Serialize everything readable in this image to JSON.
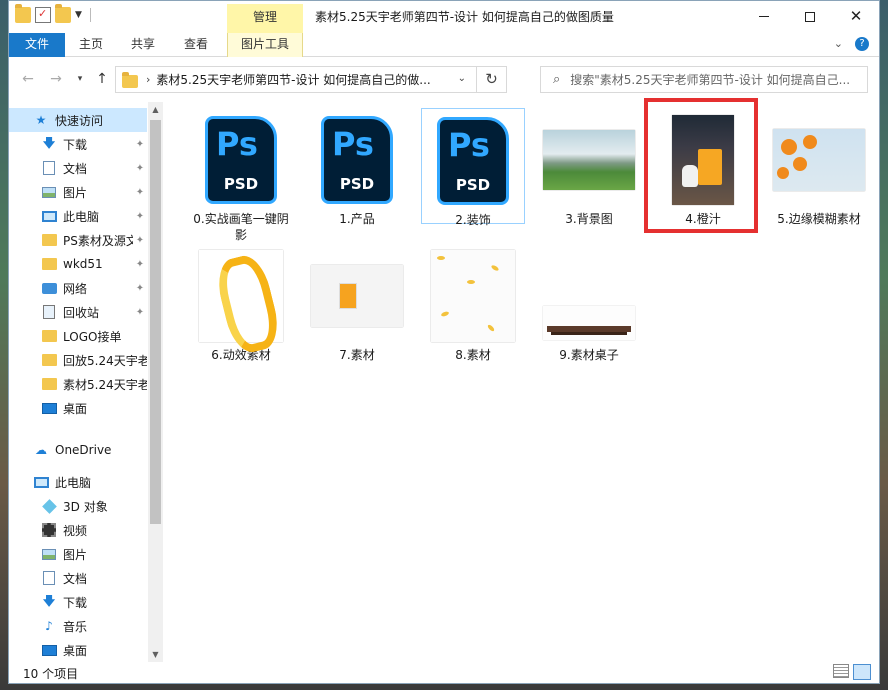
{
  "window": {
    "title": "素材5.25天宇老师第四节-设计 如何提高自己的做图质量",
    "context_tab": "管理"
  },
  "ribbon": {
    "tabs": [
      "文件",
      "主页",
      "共享",
      "查看",
      "图片工具"
    ]
  },
  "address": {
    "path": "素材5.25天宇老师第四节-设计 如何提高自己的做..."
  },
  "search": {
    "placeholder": "搜索\"素材5.25天宇老师第四节-设计 如何提高自己..."
  },
  "sidebar": {
    "items": [
      {
        "label": "快速访问",
        "icon": "star-icon",
        "pinned": false
      },
      {
        "label": "下载",
        "icon": "download-icon",
        "pinned": true
      },
      {
        "label": "文档",
        "icon": "document-icon",
        "pinned": true
      },
      {
        "label": "图片",
        "icon": "picture-icon",
        "pinned": true
      },
      {
        "label": "此电脑",
        "icon": "computer-icon",
        "pinned": true
      },
      {
        "label": "PS素材及源文",
        "icon": "folder-icon",
        "pinned": true
      },
      {
        "label": "wkd51",
        "icon": "folder-icon",
        "pinned": true
      },
      {
        "label": "网络",
        "icon": "network-icon",
        "pinned": true
      },
      {
        "label": "回收站",
        "icon": "recycle-bin-icon",
        "pinned": true
      },
      {
        "label": "LOGO接单",
        "icon": "folder-icon",
        "pinned": false
      },
      {
        "label": "回放5.24天宇老!",
        "icon": "folder-icon",
        "pinned": false
      },
      {
        "label": "素材5.24天宇老!",
        "icon": "folder-icon",
        "pinned": false
      },
      {
        "label": "桌面",
        "icon": "desktop-icon",
        "pinned": false
      },
      {
        "label": "OneDrive",
        "icon": "cloud-icon",
        "pinned": false
      },
      {
        "label": "此电脑",
        "icon": "computer-icon",
        "pinned": false
      },
      {
        "label": "3D 对象",
        "icon": "3d-objects-icon",
        "pinned": false
      },
      {
        "label": "视频",
        "icon": "video-icon",
        "pinned": false
      },
      {
        "label": "图片",
        "icon": "picture-icon",
        "pinned": false
      },
      {
        "label": "文档",
        "icon": "document-icon",
        "pinned": false
      },
      {
        "label": "下载",
        "icon": "download-icon",
        "pinned": false
      },
      {
        "label": "音乐",
        "icon": "music-icon",
        "pinned": false
      },
      {
        "label": "桌面",
        "icon": "desktop-icon",
        "pinned": false
      }
    ]
  },
  "files": [
    {
      "name": "0.实战画笔一键阴影",
      "kind": "psd"
    },
    {
      "name": "1.产品",
      "kind": "psd"
    },
    {
      "name": "2.装饰",
      "kind": "psd"
    },
    {
      "name": "3.背景图",
      "kind": "image"
    },
    {
      "name": "4.橙汁",
      "kind": "image"
    },
    {
      "name": "5.边缘模糊素材",
      "kind": "image"
    },
    {
      "name": "6.动效素材",
      "kind": "image"
    },
    {
      "name": "7.素材",
      "kind": "image"
    },
    {
      "name": "8.素材",
      "kind": "image"
    },
    {
      "name": "9.素材桌子",
      "kind": "image"
    }
  ],
  "psd_icon": {
    "glyph": "Ps",
    "label": "PSD"
  },
  "status": {
    "count": "10 个项目"
  },
  "colors": {
    "accent": "#1979ca",
    "context_tab": "#fff6a8",
    "selection": "#cce8ff",
    "highlight_box": "#e53030"
  }
}
